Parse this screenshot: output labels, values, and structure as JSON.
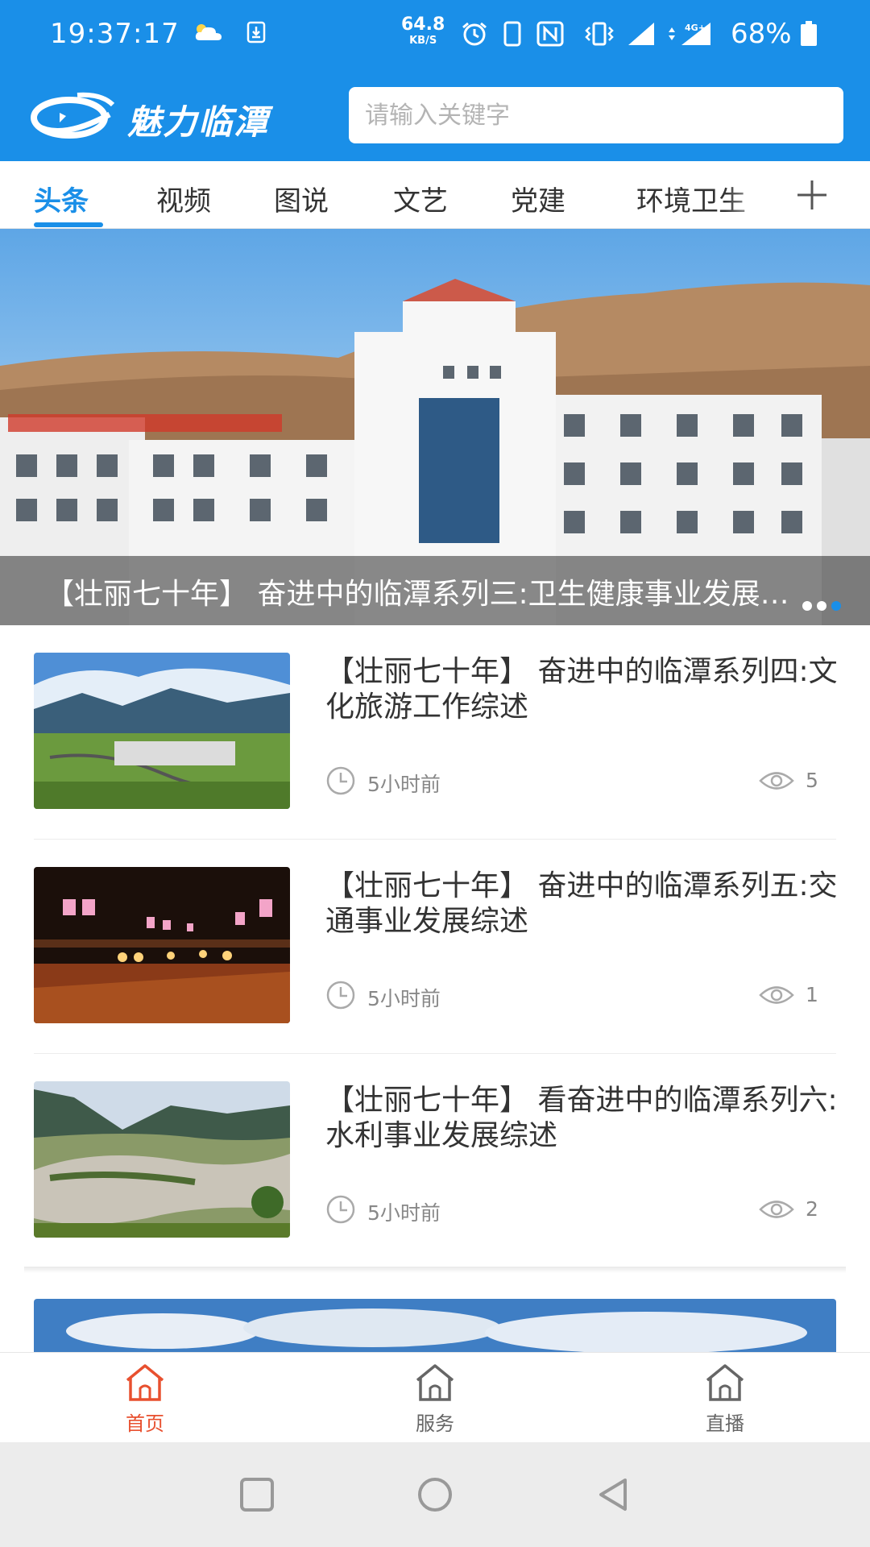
{
  "status_bar": {
    "time": "19:37:17",
    "net_speed_value": "64.8",
    "net_speed_unit": "KB/S",
    "battery": "68%",
    "icons": [
      "cloud-icon",
      "download-icon",
      "alarm-icon",
      "phone-icon",
      "nfc-icon",
      "vibrate-icon",
      "signal-icon",
      "data-4g-icon",
      "battery-icon"
    ]
  },
  "app_bar": {
    "brand": "魅力临潭",
    "search_placeholder": "请输入关键字"
  },
  "tabs": [
    {
      "label": "头条",
      "active": true
    },
    {
      "label": "视频",
      "active": false
    },
    {
      "label": "图说",
      "active": false
    },
    {
      "label": "文艺",
      "active": false
    },
    {
      "label": "党建",
      "active": false
    },
    {
      "label": "环境卫生",
      "active": false
    }
  ],
  "banner": {
    "caption": "【壮丽七十年】 奋进中的临潭系列三:卫生健康事业发展综述",
    "dots": 3,
    "active_dot": 2
  },
  "news": [
    {
      "title": "【壮丽七十年】 奋进中的临潭系列四:文化旅游工作综述",
      "time": "5小时前",
      "views": "5"
    },
    {
      "title": "【壮丽七十年】 奋进中的临潭系列五:交通事业发展综述",
      "time": "5小时前",
      "views": "1"
    },
    {
      "title": "【壮丽七十年】 看奋进中的临潭系列六:水利事业发展综述",
      "time": "5小时前",
      "views": "2"
    }
  ],
  "bottom_nav": [
    {
      "label": "首页",
      "active": true
    },
    {
      "label": "服务",
      "active": false
    },
    {
      "label": "直播",
      "active": false
    }
  ],
  "colors": {
    "brand_blue": "#1a8fe8",
    "active_nav": "#e8502f",
    "text": "#333333",
    "muted": "#888888"
  }
}
